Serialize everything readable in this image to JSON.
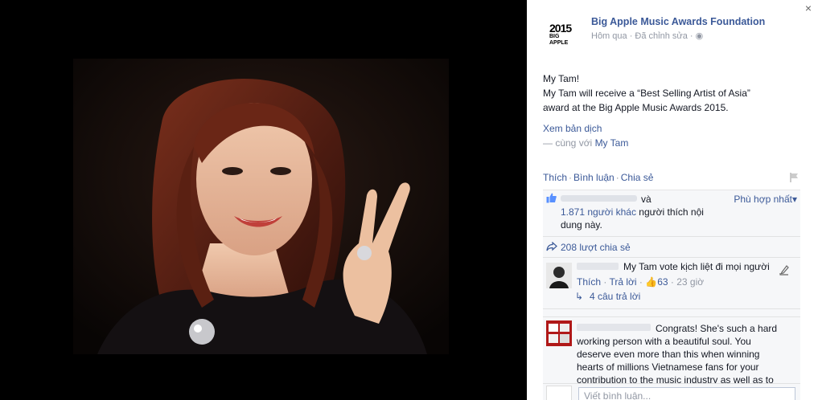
{
  "photo": {
    "alt_icon": "photo-image"
  },
  "panel": {
    "close_label": "×",
    "page_name": "Big Apple Music Awards Foundation",
    "logo_year": "2015",
    "logo_subtitle": "BIG APPLE",
    "meta": "Hôm qua · Đã chỉnh sửa · ",
    "post_line1": "My Tam!",
    "post_line2": "My Tam will receive a “Best Selling Artist of Asia”",
    "post_line3": "award at the Big Apple Music Awards 2015.",
    "see_translation": "Xem bản dịch",
    "with_prefix": "— cùng với ",
    "with_name": "My Tam",
    "actions": {
      "like": "Thích",
      "comment": "Bình luận",
      "share": "Chia sẻ"
    },
    "likes": {
      "and": "và",
      "others_link": "1.871 người khác",
      "suffix": " người thích nội dung này.",
      "sort_label": "Phù hợp nhất"
    },
    "shares_label": "208 lượt chia sẻ",
    "comments": [
      {
        "text": "My Tam vote kịch liệt đi mọi người",
        "like": "Thích",
        "reply": "Trả lời",
        "like_count": "63",
        "time": "23 giờ"
      },
      {
        "text": "Congrats! She's such a hard working person with a beautiful soul. You deserve even more than this when winning hearts of millions Vietnamese fans for your contribution to the music industry as well as to"
      }
    ],
    "replies_label": "4 câu trả lời",
    "composer_placeholder": "Viết bình luận..."
  },
  "colors": {
    "link": "#3b5998",
    "muted": "#9197a3",
    "ufi_bg": "#f6f7f9"
  }
}
